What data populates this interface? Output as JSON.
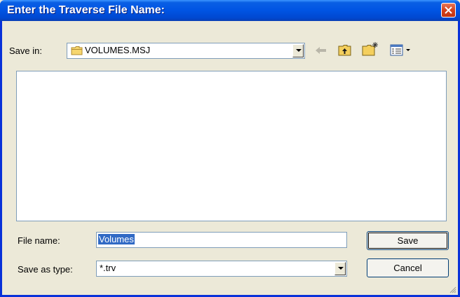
{
  "dialog": {
    "title": "Enter the Traverse File Name:"
  },
  "save_in": {
    "label": "Save in:",
    "value": "VOLUMES.MSJ",
    "folder_icon": "folder-icon"
  },
  "toolbar": {
    "icons": [
      "back-arrow-icon",
      "up-one-level-icon",
      "create-new-folder-icon",
      "view-menu-icon"
    ]
  },
  "file_name": {
    "label": "File name:",
    "value": "Volumes"
  },
  "save_as_type": {
    "label": "Save as type:",
    "value": "*.trv"
  },
  "buttons": {
    "save": "Save",
    "cancel": "Cancel"
  },
  "colors": {
    "title_bar": "#0054e3",
    "close_button": "#d3411b",
    "selection": "#316ac5",
    "window_face": "#ece9d8"
  }
}
